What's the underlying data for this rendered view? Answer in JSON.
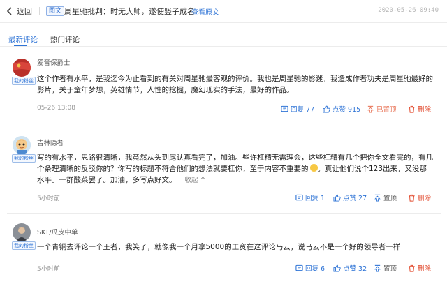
{
  "header": {
    "back_label": "返回",
    "tag_label": "图文",
    "article_title": "周星驰批判：时无大师，遂使竖子成名",
    "view_original": "查看原文",
    "timestamp": "2020-05-26 09:40"
  },
  "tabs": [
    {
      "label": "最新评论",
      "active": true
    },
    {
      "label": "热门评论",
      "active": false
    }
  ],
  "colors": {
    "accent": "#2f74d6",
    "danger": "#e24b2f",
    "text": "#222222",
    "muted": "#9a9a9a"
  },
  "comments": [
    {
      "username": "爱音保爵士",
      "badge": "我的粉丝",
      "avatar": "red-flag-avatar",
      "text_lines": [
        "这个作者有水平，是我迄今为止看到的有关对周星驰最客观的评价。我也是周星驰的影迷，我造成作者功夫是周星驰最好的",
        "影片，关于童年梦想，英雄情节，人性的挖掘，魔幻现实的手法，最好的作品。"
      ],
      "time": "05-26 13:08",
      "actions": {
        "reply": "回复 77",
        "like": "点赞 915",
        "top": "已置顶",
        "delete": "删除"
      }
    },
    {
      "username": "吉林隐者",
      "badge": "我的粉丝",
      "avatar": "cartoon-avatar",
      "text_lines": [
        "写的有水平，思路很清晰，我竟然从头到尾认真看完了，加油。些许杠精无需理会，这些杠精有几个把你全文看完的，有几",
        "个条理清晰的反驳你的？你写的标题不符合他们的想法就要杠你，至于内容不重要的",
        "水平。一群酸菜罢了。加油，多写点好文。"
      ],
      "line2_tail": "。真让他们说个123出来，又没那",
      "collapse": "收起 ^",
      "time": "5小时前",
      "actions": {
        "reply": "回复 1",
        "like": "点赞 27",
        "top": "置顶",
        "delete": "删除"
      }
    },
    {
      "username": "SKT/瓜皮中单",
      "badge": "我的粉丝",
      "avatar": "photo-avatar",
      "text_lines": [
        "一个青铜去评论一个王者，我笑了，就像我一个月拿5000的工资在这评论马云，说马云不是一个好的领导者一样"
      ],
      "time": "5小时前",
      "actions": {
        "reply": "回复 6",
        "like": "点赞 32",
        "top": "置顶",
        "delete": "删除"
      }
    }
  ]
}
